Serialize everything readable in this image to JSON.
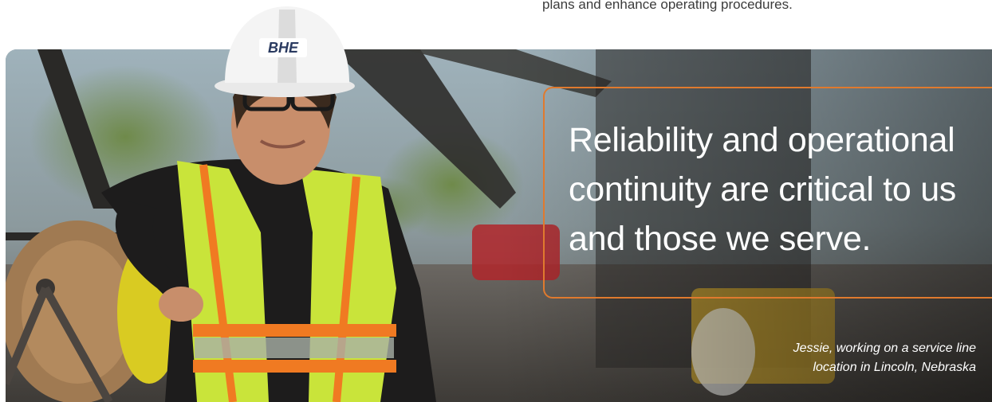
{
  "intro": {
    "trailing_line": "plans and enhance operating procedures."
  },
  "photo": {
    "subject": "Worker in hard hat and safety vest",
    "helmet_text": "BHE"
  },
  "pull_quote": {
    "text": "Reliability and operational continuity are critical to us and those we serve."
  },
  "caption": {
    "line1": "Jessie, working on a service line",
    "line2": "location in Lincoln, Nebraska"
  },
  "colors": {
    "accent_border": "#e07a2e",
    "vest_yellow": "#c9e43a",
    "vest_stripe_orange": "#f07a22"
  }
}
